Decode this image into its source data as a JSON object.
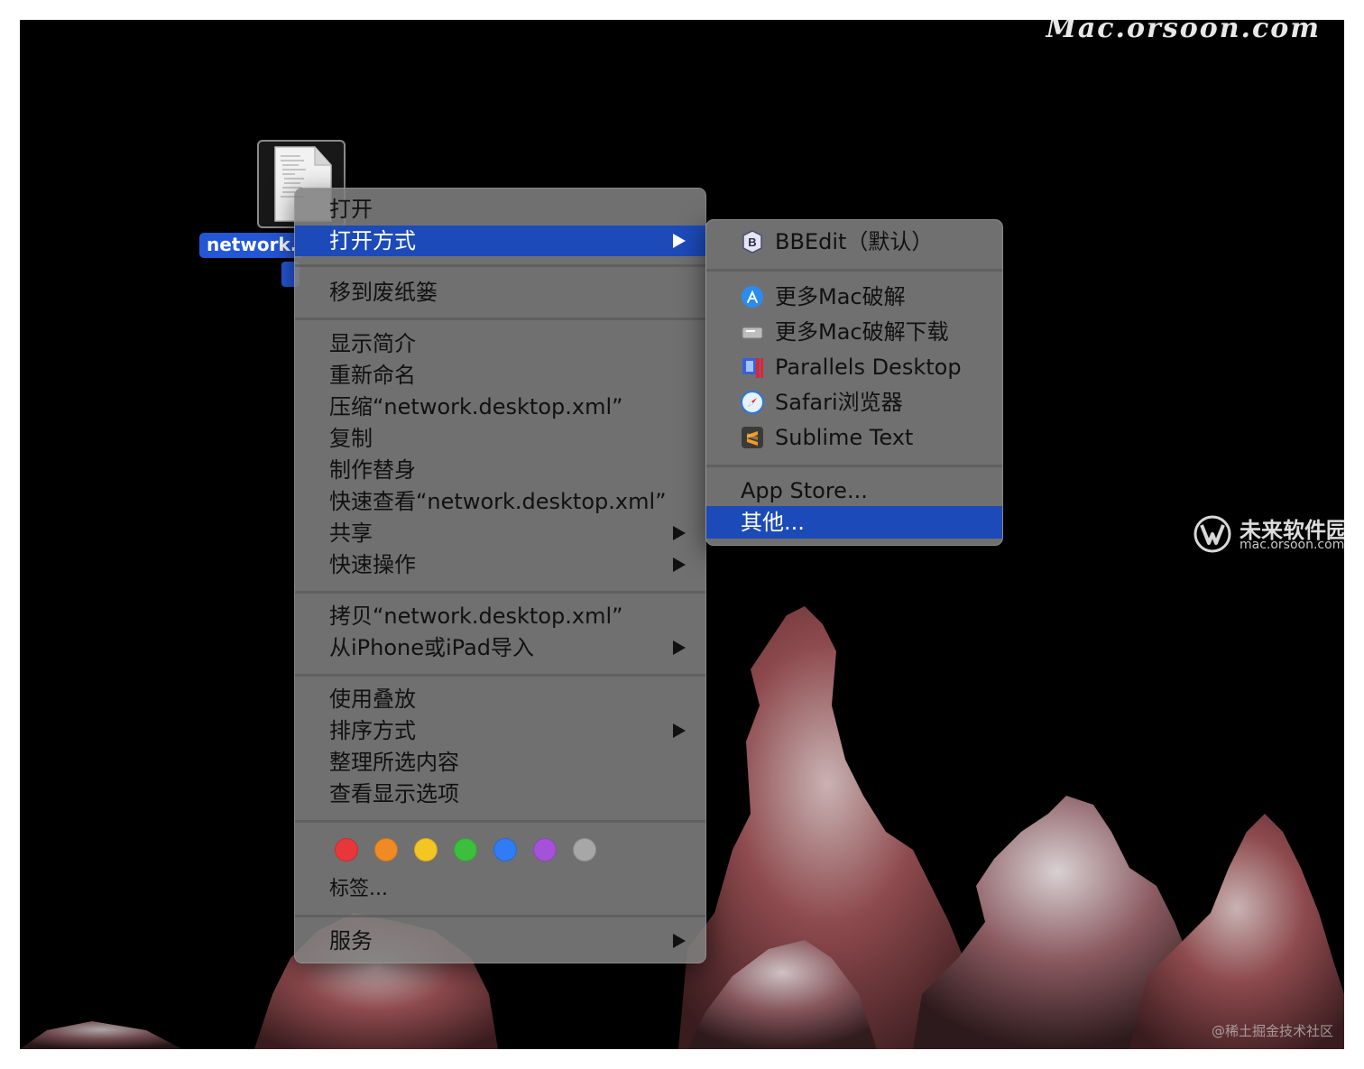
{
  "watermark": {
    "top": "Mac.orsoon.com",
    "brand_name": "未来软件园",
    "brand_site": "mac.orsoon.com",
    "credit": "@稀土掘金技术社区"
  },
  "desktop": {
    "file_label": "network."
  },
  "context_menu": {
    "sections": [
      {
        "items": [
          {
            "label": "打开",
            "submenu": false,
            "highlighted": false
          },
          {
            "label": "打开方式",
            "submenu": true,
            "highlighted": true
          }
        ]
      },
      {
        "items": [
          {
            "label": "移到废纸篓",
            "submenu": false
          }
        ]
      },
      {
        "items": [
          {
            "label": "显示简介",
            "submenu": false
          },
          {
            "label": "重新命名",
            "submenu": false
          },
          {
            "label": "压缩“network.desktop.xml”",
            "submenu": false
          },
          {
            "label": "复制",
            "submenu": false
          },
          {
            "label": "制作替身",
            "submenu": false
          },
          {
            "label": "快速查看“network.desktop.xml”",
            "submenu": false
          },
          {
            "label": "共享",
            "submenu": true
          },
          {
            "label": "快速操作",
            "submenu": true
          }
        ]
      },
      {
        "items": [
          {
            "label": "拷贝“network.desktop.xml”",
            "submenu": false
          },
          {
            "label": "从iPhone或iPad导入",
            "submenu": true
          }
        ]
      },
      {
        "items": [
          {
            "label": "使用叠放",
            "submenu": false
          },
          {
            "label": "排序方式",
            "submenu": true
          },
          {
            "label": "整理所选内容",
            "submenu": false
          },
          {
            "label": "查看显示选项",
            "submenu": false
          }
        ]
      },
      {
        "tags": [
          "#e8373a",
          "#f08a24",
          "#f5c523",
          "#3cbf3c",
          "#2f7cf6",
          "#a452d8",
          "#a7a7a7"
        ],
        "tags_label": "标签..."
      },
      {
        "items": [
          {
            "label": "服务",
            "submenu": true
          }
        ]
      }
    ]
  },
  "open_with_submenu": {
    "default_app": {
      "label": "BBEdit（默认）",
      "icon": "bbedit-icon"
    },
    "apps": [
      {
        "label": "更多Mac破解",
        "icon": "app-store-icon"
      },
      {
        "label": "更多Mac破解下载",
        "icon": "generic-app-icon"
      },
      {
        "label": "Parallels Desktop",
        "icon": "parallels-icon"
      },
      {
        "label": "Safari浏览器",
        "icon": "safari-icon"
      },
      {
        "label": "Sublime Text",
        "icon": "sublime-icon"
      }
    ],
    "app_store": "App Store...",
    "other": "其他..."
  }
}
